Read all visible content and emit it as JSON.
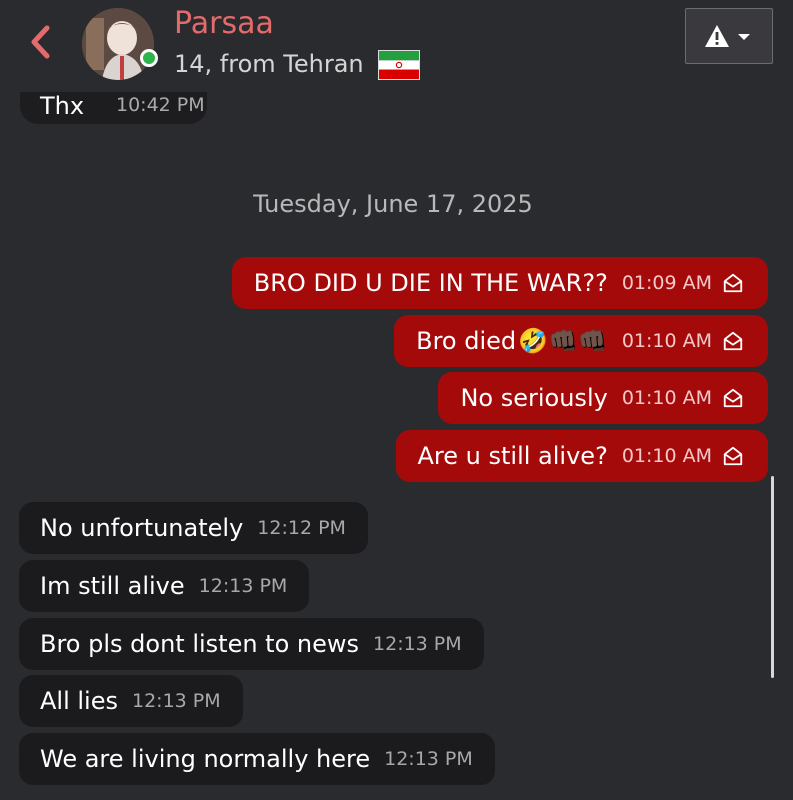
{
  "header": {
    "contact_name": "Parsaa",
    "subtitle": "14, from Tehran",
    "status": "online",
    "back_icon": "chevron-left-icon",
    "menu_icon": "warning-icon"
  },
  "colors": {
    "accent": "#e46b6b",
    "outgoing_bubble": "#a50a0a",
    "incoming_bubble": "#1b1b1e",
    "background": "#2a2b2f",
    "online": "#2fb34b"
  },
  "previous_message": {
    "text": "Thx",
    "time": "10:42 PM"
  },
  "date_separator": "Tuesday, June 17, 2025",
  "outgoing": [
    {
      "text": "BRO DID U DIE IN THE WAR??",
      "time": "01:09 AM"
    },
    {
      "text": "Bro died",
      "time": "01:10 AM",
      "emojis": "🤣👊🏿👊🏿"
    },
    {
      "text": "No seriously",
      "time": "01:10 AM"
    },
    {
      "text": "Are u still alive?",
      "time": "01:10 AM"
    }
  ],
  "incoming": [
    {
      "text": "No unfortunately",
      "time": "12:12 PM"
    },
    {
      "text": "Im still alive",
      "time": "12:13 PM"
    },
    {
      "text": "Bro pls dont listen to news",
      "time": "12:13 PM"
    },
    {
      "text": "All lies",
      "time": "12:13 PM"
    },
    {
      "text": "We are living normally here",
      "time": "12:13 PM"
    }
  ]
}
